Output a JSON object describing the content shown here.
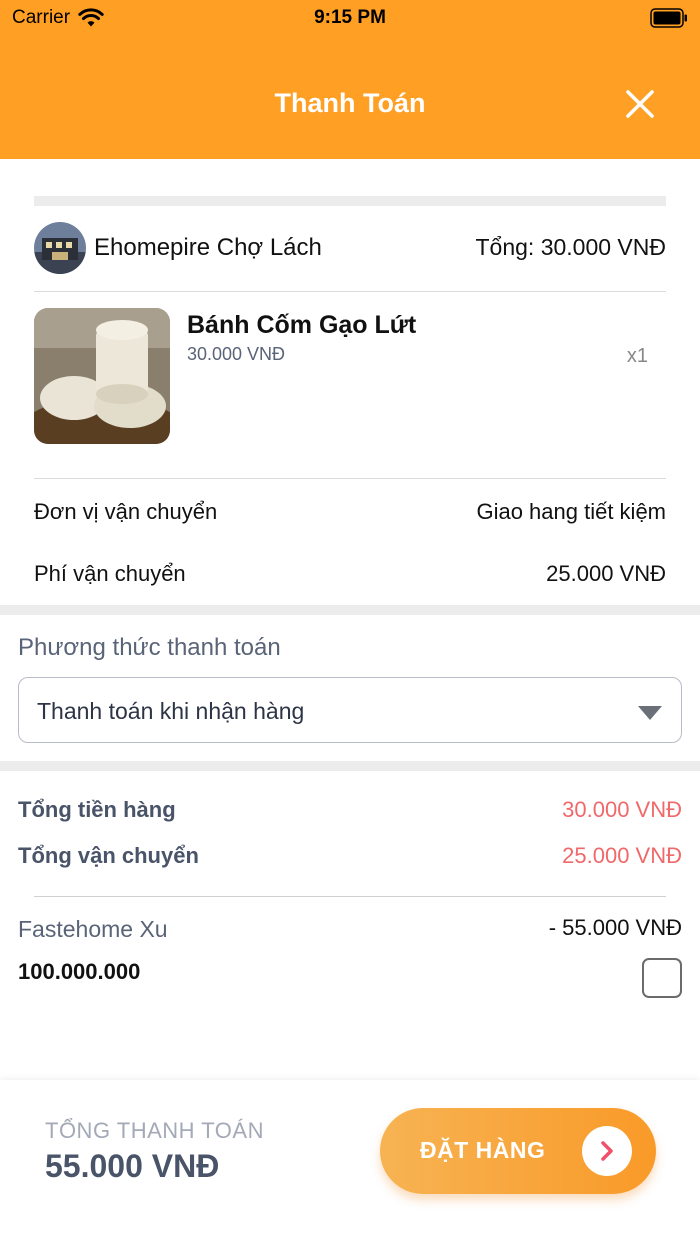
{
  "status_bar": {
    "carrier": "Carrier",
    "time": "9:15 PM"
  },
  "header": {
    "title": "Thanh Toán"
  },
  "shop": {
    "name": "Ehomepire Chợ Lách",
    "total": "Tổng: 30.000 VNĐ"
  },
  "product": {
    "name": "Bánh Cốm Gạo Lứt",
    "price": "30.000 VNĐ",
    "quantity": "x1"
  },
  "shipping": {
    "unit_label": "Đơn vị vận chuyển",
    "unit_value": "Giao hang tiết kiệm",
    "fee_label": "Phí vận chuyển",
    "fee_value": "25.000 VNĐ"
  },
  "payment": {
    "label": "Phương thức thanh toán",
    "selected": "Thanh toán khi nhận hàng"
  },
  "summary": {
    "goods_label": "Tổng tiền hàng",
    "goods_value": "30.000 VNĐ",
    "ship_label": "Tổng vận chuyển",
    "ship_value": "25.000 VNĐ"
  },
  "xu": {
    "label": "Fastehome Xu",
    "discount": "- 55.000 VNĐ",
    "balance": "100.000.000",
    "checked": false
  },
  "footer": {
    "total_label": "TỔNG THANH TOÁN",
    "total_value": "55.000 VNĐ",
    "order_label": "ĐẶT HÀNG"
  },
  "colors": {
    "header": "#FF9F24",
    "price_red": "#F0696A",
    "button_start": "#F7B353",
    "button_end": "#F99A28"
  },
  "icons": [
    "wifi-icon",
    "battery-icon",
    "close-icon",
    "dropdown-caret-icon",
    "chevron-right-icon"
  ]
}
